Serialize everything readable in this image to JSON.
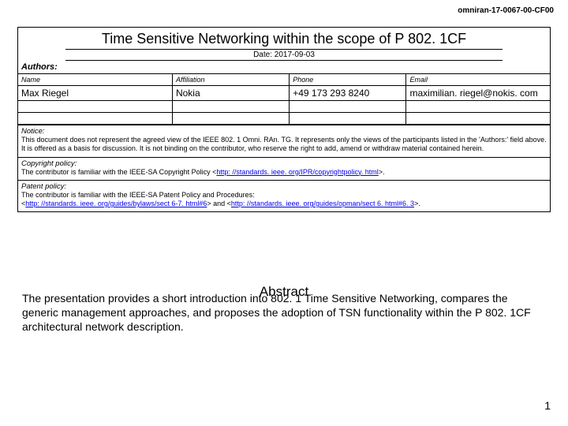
{
  "doc_id": "omniran-17-0067-00-CF00",
  "title": "Time Sensitive Networking within the scope of P 802. 1CF",
  "date_line": "Date: 2017-09-03",
  "authors_label": "Authors:",
  "authors_table": {
    "cols": {
      "name": "Name",
      "affiliation": "Affiliation",
      "phone": "Phone",
      "email": "Email"
    },
    "rows": [
      {
        "name": "Max Riegel",
        "affiliation": "Nokia",
        "phone": "+49 173 293 8240",
        "email": "maximilian. riegel@nokis. com"
      }
    ]
  },
  "notice": {
    "heading": "Notice:",
    "body": "This document does not represent the agreed view of the IEEE 802. 1 Omni. RAn. TG. It represents only the views of the participants listed in the 'Authors:' field above. It is offered as a basis for discussion. It is not binding on the contributor, who reserve the right to add, amend or withdraw material contained herein."
  },
  "copyright": {
    "heading": "Copyright policy:",
    "prefix": "The contributor is familiar with the IEEE-SA Copyright Policy <",
    "link": "http: //standards. ieee. org/IPR/copyrightpolicy. html",
    "suffix": ">."
  },
  "patent": {
    "heading": "Patent policy:",
    "line1": "The contributor is familiar with the IEEE-SA Patent Policy and Procedures:",
    "link1": "http: //standards. ieee. org/guides/bylaws/sect 6-7. html#6",
    "mid": "> and <",
    "link2": "http: //standards. ieee. org/guides/opman/sect 6. html#6. 3",
    "suffix": ">."
  },
  "abstract": {
    "heading": "Abstract",
    "body": "The presentation provides a short introduction into 802. 1 Time Sensitive Networking, compares the generic management approaches, and proposes the adoption of TSN functionality within the P 802. 1CF architectural network description."
  },
  "page_number": "1"
}
